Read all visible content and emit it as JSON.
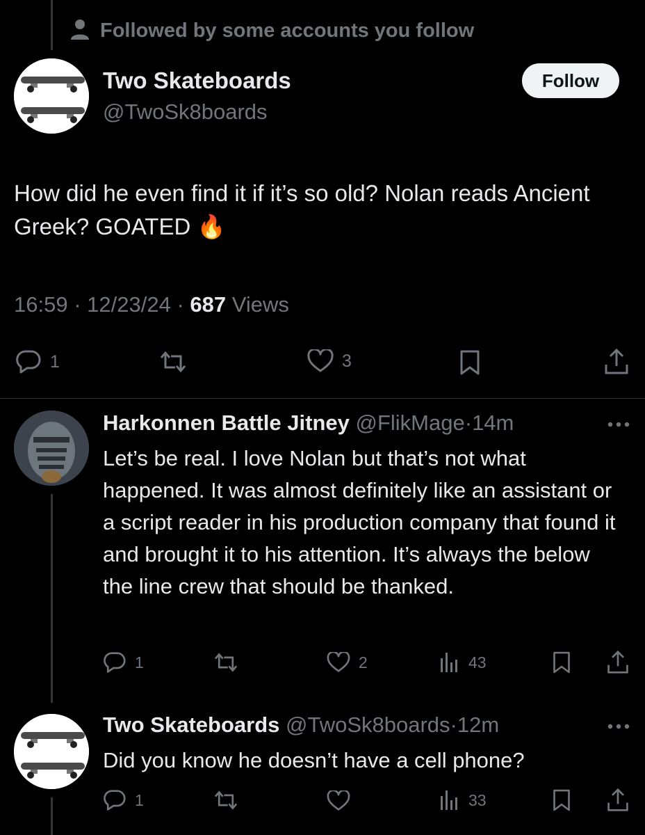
{
  "social_context": {
    "text": "Followed by some accounts you follow",
    "icon": "person-icon"
  },
  "main_tweet": {
    "author_name": "Two Skateboards",
    "author_handle": "@TwoSk8boards",
    "follow_label": "Follow",
    "text": "How did he even find it if it’s so old? Nolan reads Ancient Greek? GOATED",
    "emoji": "🔥",
    "time": "16:59",
    "date": "12/23/24",
    "sep": "·",
    "views_count": "687",
    "views_label": "Views",
    "actions": {
      "replies": "1",
      "reposts": "",
      "likes": "3"
    }
  },
  "replies": [
    {
      "author_name": "Harkonnen Battle Jitney",
      "author_handle": "@FlikMage",
      "sep": "·",
      "time": "14m",
      "text": "Let’s be real. I love Nolan but that’s not what happened. It was almost definitely like an assistant or a script reader in his production company that found it and brought it to his attention. It’s always the below the line crew that should be thanked.",
      "actions": {
        "replies": "1",
        "likes": "2",
        "views": "43"
      }
    },
    {
      "author_name": "Two Skateboards",
      "author_handle": "@TwoSk8boards",
      "sep": "·",
      "time": "12m",
      "text": "Did you know he doesn’t have a cell phone?",
      "actions": {
        "replies": "1",
        "likes": "",
        "views": "33"
      }
    }
  ],
  "colors": {
    "background": "#000000",
    "text": "#e7e9ea",
    "muted": "#71767b",
    "divider": "#2f3336"
  }
}
